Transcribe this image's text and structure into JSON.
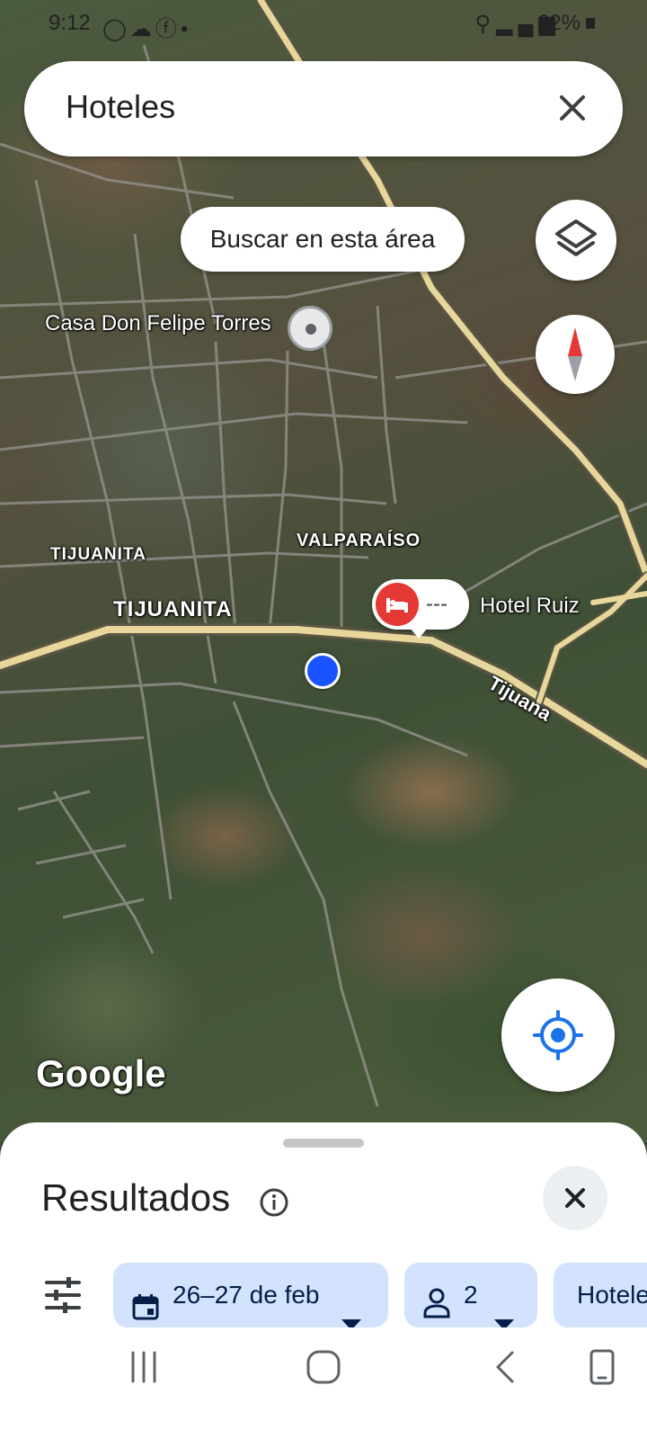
{
  "status_bar": {
    "time": "9:12",
    "left_icons": [
      "whatsapp-icon",
      "cloud-icon",
      "facebook-icon",
      "dot-icon"
    ],
    "right_icons": [
      "location-icon",
      "4g-icon",
      "signal-icon"
    ],
    "battery": "62%"
  },
  "search": {
    "query": "Hoteles"
  },
  "map": {
    "search_area_label": "Buscar en esta área",
    "labels": {
      "casa": "Casa Don Felipe Torres",
      "tijuanita_small": "TIJUANITA",
      "tijuanita_large": "TIJUANITA",
      "valparaiso": "VALPARAÍSO",
      "hotel_ruiz": "Hotel Ruiz",
      "road_tijuana": "Tijuana"
    },
    "hotel_pin_price": "---",
    "logo": "Google"
  },
  "sheet": {
    "title": "Resultados",
    "chips": {
      "dates": "26–27 de feb",
      "guests": "2",
      "type": "Hoteles"
    }
  },
  "colors": {
    "chip_bg": "#d3e3fd",
    "chip_text": "#041e49",
    "hotel_pin": "#e53935",
    "location_dot": "#1a53ff",
    "locate_icon": "#1a73e8"
  }
}
